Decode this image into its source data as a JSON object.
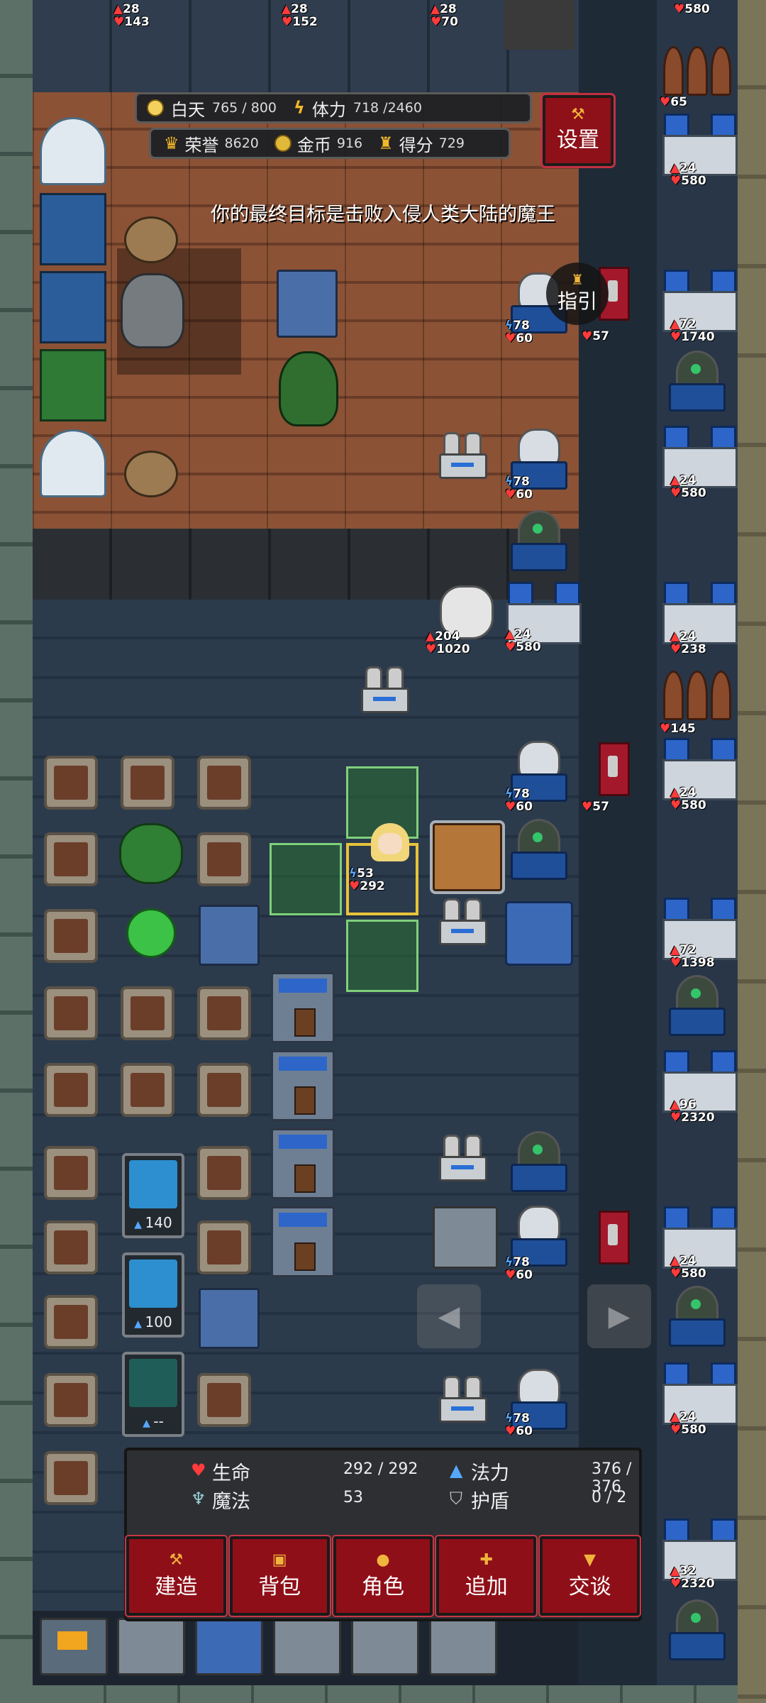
{
  "hud": {
    "time_label": "白天",
    "time_value": "765 / 800",
    "stamina_label": "体力",
    "stamina_value": "718 /2460",
    "honor_label": "荣誉",
    "honor_value": "8620",
    "gold_label": "金币",
    "gold_value": "916",
    "score_label": "得分",
    "score_value": "729",
    "settings_label": "设置",
    "goal_text": "你的最终目标是击败入侵人类大陆的魔王",
    "guide_label": "指引"
  },
  "player_stats": {
    "hp_label": "生命",
    "hp_value": "292 / 292",
    "mp_label": "法力",
    "mp_value": "376 / 376",
    "magic_label": "魔法",
    "magic_value": "53",
    "shield_label": "护盾",
    "shield_value": "0  /  2"
  },
  "menu": {
    "build": "建造",
    "bag": "背包",
    "character": "角色",
    "add": "追加",
    "talk": "交谈"
  },
  "hero_overlay": {
    "atk": "53",
    "hp": "292"
  },
  "enemy_overlay": {
    "atk": "204",
    "hp": "1020"
  },
  "skill_cards": [
    {
      "cost": "140"
    },
    {
      "cost": "100"
    },
    {
      "cost": "--"
    }
  ],
  "top_units": [
    {
      "atk": "28",
      "hp": "143"
    },
    {
      "atk": "28",
      "hp": "152"
    },
    {
      "atk": "28",
      "hp": "70"
    }
  ],
  "pylon_stats": [
    {
      "atk": "78",
      "hp": "60"
    },
    {
      "atk": "78",
      "hp": "60"
    },
    {
      "atk": "78",
      "hp": "60"
    },
    {
      "atk": "78",
      "hp": "60"
    },
    {
      "atk": "78",
      "hp": "60"
    }
  ],
  "castle_stats": [
    {
      "atk": "24",
      "hp": "580"
    },
    {
      "atk": "24",
      "hp": "580"
    },
    {
      "atk": "24",
      "hp": "580"
    }
  ],
  "banner_hp": [
    "57",
    "57"
  ],
  "right_column": {
    "top_hp": "580",
    "spikes1_hp": "65",
    "spikes2_hp": "145",
    "castles": [
      {
        "atk": "24",
        "hp": "580"
      },
      {
        "atk": "72",
        "hp": "1740"
      },
      {
        "atk": "24",
        "hp": "580"
      },
      {
        "atk": "24",
        "hp": "238"
      },
      {
        "atk": "24",
        "hp": "580"
      },
      {
        "atk": "72",
        "hp": "1398"
      },
      {
        "atk": "96",
        "hp": "2320"
      },
      {
        "atk": "24",
        "hp": "580"
      },
      {
        "atk": "24",
        "hp": "580"
      },
      {
        "atk": "32",
        "hp": "2320"
      }
    ]
  },
  "colors": {
    "button_red": "#8f0f18",
    "gold": "#f0b43c",
    "hp_red": "#ff3b3b",
    "mp_blue": "#56a8ff",
    "highlight_green": "#7fd07a",
    "select_yellow": "#e8c33a"
  },
  "icons": [
    "sun-icon",
    "bolt-icon",
    "crown-icon",
    "coin-icon",
    "trophy-icon",
    "hammer-icon",
    "heart-icon",
    "potion-icon",
    "spirit-icon",
    "shield-icon",
    "arrow-left-icon",
    "arrow-right-icon"
  ]
}
